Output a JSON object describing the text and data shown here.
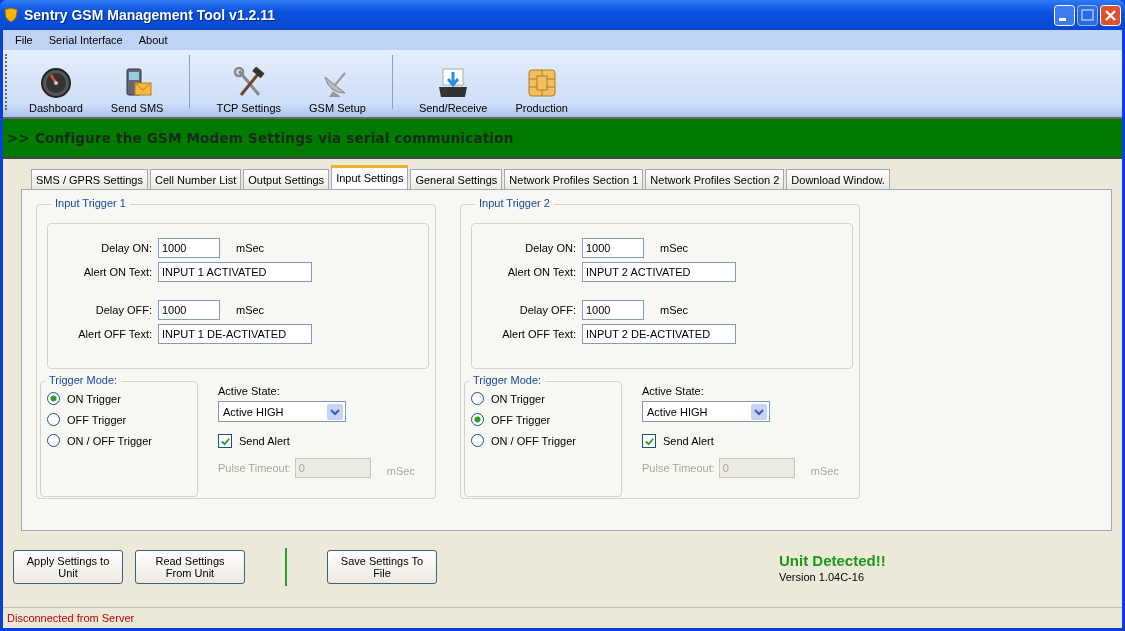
{
  "window": {
    "title": "Sentry GSM Management Tool v1.2.11"
  },
  "menu": [
    "File",
    "Serial Interface",
    "About"
  ],
  "toolbar": [
    {
      "label": "Dashboard",
      "kind": "gauge"
    },
    {
      "label": "Send SMS",
      "kind": "phone"
    },
    {
      "label": "TCP Settings",
      "kind": "tools",
      "group_start": true
    },
    {
      "label": "GSM Setup",
      "kind": "dish"
    },
    {
      "label": "Send/Receive",
      "kind": "inbox",
      "group_start": true
    },
    {
      "label": "Production",
      "kind": "chip"
    }
  ],
  "banner": ">> Configure the GSM Modem Settings via serial communication",
  "tabs": [
    {
      "label": "SMS / GPRS Settings",
      "selected": false
    },
    {
      "label": "Cell Number List",
      "selected": false
    },
    {
      "label": "Output Settings",
      "selected": false
    },
    {
      "label": "Input Settings",
      "selected": true
    },
    {
      "label": "General Settings",
      "selected": false
    },
    {
      "label": "Network Profiles Section 1",
      "selected": false
    },
    {
      "label": "Network Profiles Section 2",
      "selected": false
    },
    {
      "label": "Download Window.",
      "selected": false
    }
  ],
  "triggers": [
    {
      "title": "Input Trigger 1",
      "delay_on": {
        "label": "Delay ON:",
        "value": "1000",
        "unit": "mSec"
      },
      "alert_on": {
        "label": "Alert ON Text:",
        "value": "INPUT 1 ACTIVATED"
      },
      "delay_off": {
        "label": "Delay OFF:",
        "value": "1000",
        "unit": "mSec"
      },
      "alert_off": {
        "label": "Alert OFF Text:",
        "value": "INPUT 1 DE-ACTIVATED"
      },
      "mode_title": "Trigger Mode:",
      "modes": [
        {
          "label": "ON Trigger",
          "selected": true
        },
        {
          "label": "OFF Trigger",
          "selected": false
        },
        {
          "label": "ON / OFF Trigger",
          "selected": false
        }
      ],
      "active_state": {
        "label": "Active State:",
        "value": "Active HIGH"
      },
      "send_alert": {
        "label": "Send Alert",
        "checked": true
      },
      "pulse_timeout": {
        "label": "Pulse Timeout:",
        "value": "0",
        "unit": "mSec",
        "disabled": true
      }
    },
    {
      "title": "Input Trigger 2",
      "delay_on": {
        "label": "Delay ON:",
        "value": "1000",
        "unit": "mSec"
      },
      "alert_on": {
        "label": "Alert ON Text:",
        "value": "INPUT 2 ACTIVATED"
      },
      "delay_off": {
        "label": "Delay OFF:",
        "value": "1000",
        "unit": "mSec"
      },
      "alert_off": {
        "label": "Alert OFF Text:",
        "value": "INPUT 2 DE-ACTIVATED"
      },
      "mode_title": "Trigger Mode:",
      "modes": [
        {
          "label": "ON Trigger",
          "selected": false
        },
        {
          "label": "OFF Trigger",
          "selected": true
        },
        {
          "label": "ON / OFF Trigger",
          "selected": false
        }
      ],
      "active_state": {
        "label": "Active State:",
        "value": "Active HIGH"
      },
      "send_alert": {
        "label": "Send Alert",
        "checked": true
      },
      "pulse_timeout": {
        "label": "Pulse Timeout:",
        "value": "0",
        "unit": "mSec",
        "disabled": true
      }
    }
  ],
  "buttons": [
    {
      "label": "Apply Settings to Unit",
      "group_start": false
    },
    {
      "label": "Read Settings From Unit",
      "group_start": false
    },
    {
      "label": "Save Settings To File",
      "group_start": true
    }
  ],
  "unit_status": {
    "title": "Unit Detected!!",
    "version": "Version 1.04C-16"
  },
  "status_bar": "Disconnected from Server"
}
